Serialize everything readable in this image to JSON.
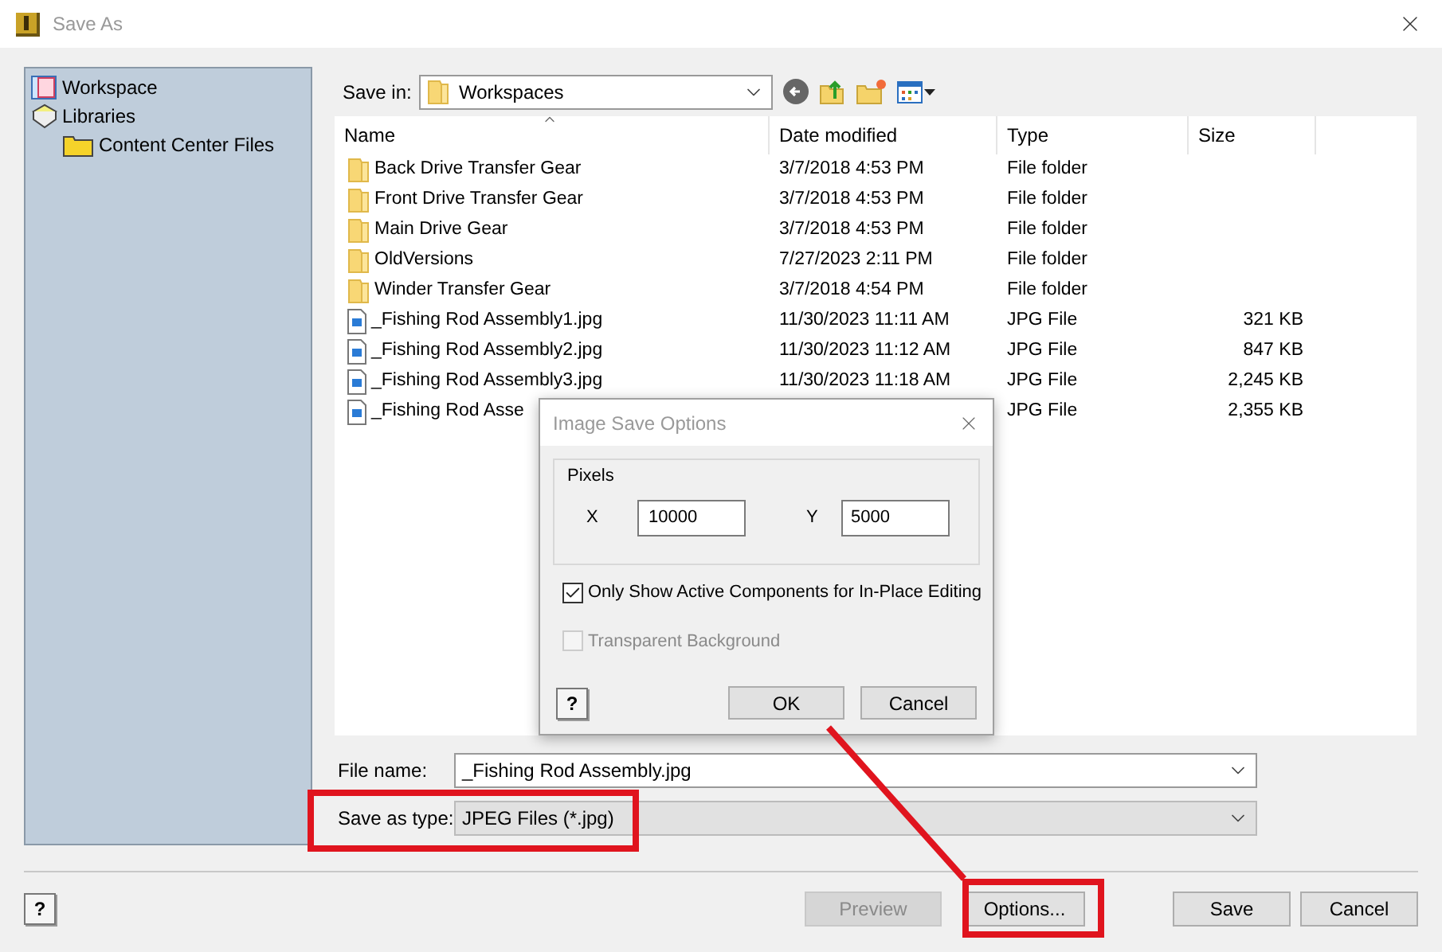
{
  "window": {
    "title": "Save As"
  },
  "sidebar": {
    "items": [
      {
        "kind": "workspace",
        "label": "Workspace"
      },
      {
        "kind": "library",
        "label": "Libraries",
        "children": [
          {
            "kind": "folder",
            "label": "Content Center Files"
          }
        ]
      }
    ]
  },
  "save_in": {
    "label": "Save in:",
    "value": "Workspaces"
  },
  "file_list": {
    "columns": [
      "Name",
      "Date modified",
      "Type",
      "Size"
    ],
    "rows": [
      {
        "kind": "folder",
        "name": "Back Drive Transfer Gear",
        "date": "3/7/2018 4:53 PM",
        "type": "File folder"
      },
      {
        "kind": "folder",
        "name": "Front Drive Transfer Gear",
        "date": "3/7/2018 4:53 PM",
        "type": "File folder"
      },
      {
        "kind": "folder",
        "name": "Main Drive Gear",
        "date": "3/7/2018 4:53 PM",
        "type": "File folder"
      },
      {
        "kind": "folder",
        "name": "OldVersions",
        "date": "7/27/2023 2:11 PM",
        "type": "File folder"
      },
      {
        "kind": "folder",
        "name": "Winder Transfer Gear",
        "date": "3/7/2018 4:54 PM",
        "type": "File folder"
      },
      {
        "kind": "image",
        "name": "_Fishing Rod Assembly1.jpg",
        "date": "11/30/2023 11:11 AM",
        "type": "JPG File",
        "size": "321 KB"
      },
      {
        "kind": "image",
        "name": "_Fishing Rod Assembly2.jpg",
        "date": "11/30/2023 11:12 AM",
        "type": "JPG File",
        "size": "847 KB"
      },
      {
        "kind": "image",
        "name": "_Fishing Rod Assembly3.jpg",
        "date": "11/30/2023 11:18 AM",
        "type": "JPG File",
        "size": "2,245 KB"
      },
      {
        "kind": "image",
        "name": "_Fishing Rod Asse",
        "type": "JPG File",
        "size": "2,355 KB"
      }
    ]
  },
  "file_name": {
    "label": "File name:",
    "value": "_Fishing Rod Assembly.jpg"
  },
  "save_as_type": {
    "label": "Save as type:",
    "value": "JPEG Files (*.jpg)"
  },
  "help_button": "?",
  "buttons": [
    {
      "label": "Preview",
      "disabled": true
    },
    {
      "label": "Options...",
      "disabled": false
    },
    {
      "label": "Save",
      "disabled": false
    },
    {
      "label": "Cancel",
      "disabled": false
    }
  ],
  "dialog": {
    "title": "Image Save Options",
    "group": "Pixels",
    "x_label": "X",
    "x_value": "10000",
    "y_label": "Y",
    "y_value": "5000",
    "checkboxes": [
      {
        "label": "Only Show Active Components for In-Place Editing",
        "checked": true,
        "disabled": false
      },
      {
        "label": "Transparent Background",
        "checked": false,
        "disabled": true
      }
    ],
    "help_button": "?",
    "buttons": [
      "OK",
      "Cancel"
    ]
  }
}
